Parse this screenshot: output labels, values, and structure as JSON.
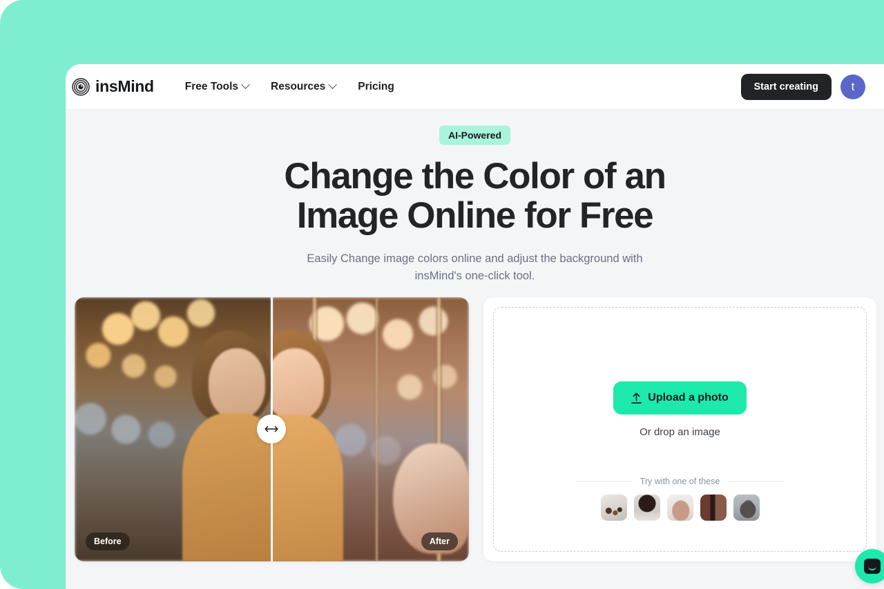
{
  "brand": {
    "name": "insMind",
    "logo_icon": "concentric-rings-logo-icon"
  },
  "header": {
    "nav": [
      {
        "label": "Free Tools",
        "has_chevron": true,
        "icon": "chevron-down-icon"
      },
      {
        "label": "Resources",
        "has_chevron": true,
        "icon": "chevron-down-icon"
      },
      {
        "label": "Pricing",
        "has_chevron": false
      }
    ],
    "cta_label": "Start creating",
    "avatar_initial": "t",
    "avatar_color": "#5B66CB"
  },
  "hero": {
    "badge": "AI-Powered",
    "title_line1": "Change the Color of an",
    "title_line2": "Image Online for Free",
    "subtitle": "Easily Change image colors online and adjust the background with insMind's one-click tool."
  },
  "comparison": {
    "before_label": "Before",
    "after_label": "After",
    "handle_icon": "horizontal-resize-arrows-icon",
    "subject": "girl at carousel with bokeh lights"
  },
  "upload": {
    "button_label": "Upload a photo",
    "button_icon": "upload-arrow-icon",
    "drop_hint": "Or drop an image",
    "try_label": "Try with one of these",
    "samples": [
      {
        "name": "cosmetics-bottles",
        "class": "t-cosmetics"
      },
      {
        "name": "woman-portrait",
        "class": "t-woman"
      },
      {
        "name": "handbag",
        "class": "t-bag"
      },
      {
        "name": "dark-product-shot",
        "class": "t-product"
      },
      {
        "name": "cat",
        "class": "t-cat"
      }
    ]
  },
  "chat": {
    "icon": "chat-smiley-icon"
  },
  "colors": {
    "mint_frame": "#7FEDD0",
    "accent_green": "#1DE9AC",
    "badge_green": "#A8F5DC",
    "dark": "#212327",
    "page_bg": "#F4F5F7"
  }
}
